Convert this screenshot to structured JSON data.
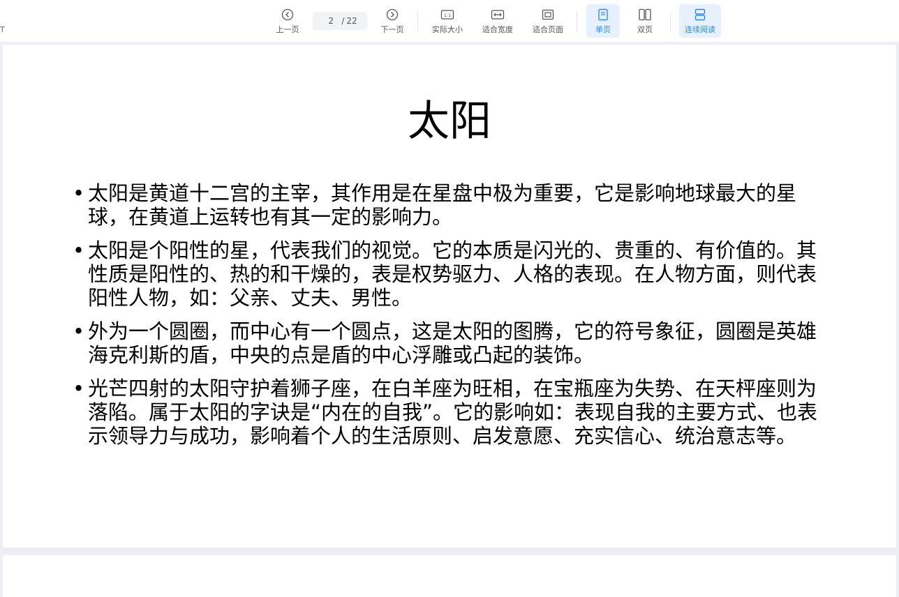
{
  "toolbar": {
    "edge_fragment": "T",
    "prev_label": "上一页",
    "next_label": "下一页",
    "current_page": "2",
    "page_separator": "/",
    "total_pages": "22",
    "actual_size_label": "实际大小",
    "fit_width_label": "适合宽度",
    "fit_page_label": "适合页面",
    "single_page_label": "单页",
    "double_page_label": "双页",
    "continuous_label": "连续阅读",
    "active_mode": "single_page",
    "active_color": "#2a8cf0"
  },
  "slide": {
    "title": "太阳",
    "bullets": [
      "太阳是黄道十二宫的主宰，其作用是在星盘中极为重要，它是影响地球最大的星球，在黄道上运转也有其一定的影响力。",
      "太阳是个阳性的星，代表我们的视觉。它的本质是闪光的、贵重的、有价值的。其性质是阳性的、热的和干燥的，表是权势驱力、人格的表现。在人物方面，则代表阳性人物，如：父亲、丈夫、男性。",
      "外为一个圆圈，而中心有一个圆点，这是太阳的图腾，它的符号象征，圆圈是英雄海克利斯的盾，中央的点是盾的中心浮雕或凸起的装饰。",
      "光芒四射的太阳守护着狮子座，在白羊座为旺相，在宝瓶座为失势、在天枰座则为落陷。属于太阳的字诀是“内在的自我”。它的影响如：表现自我的主要方式、也表示领导力与成功，影响着个人的生活原则、启发意愿、充实信心、统治意志等。"
    ],
    "bullet_glyph": "•"
  }
}
